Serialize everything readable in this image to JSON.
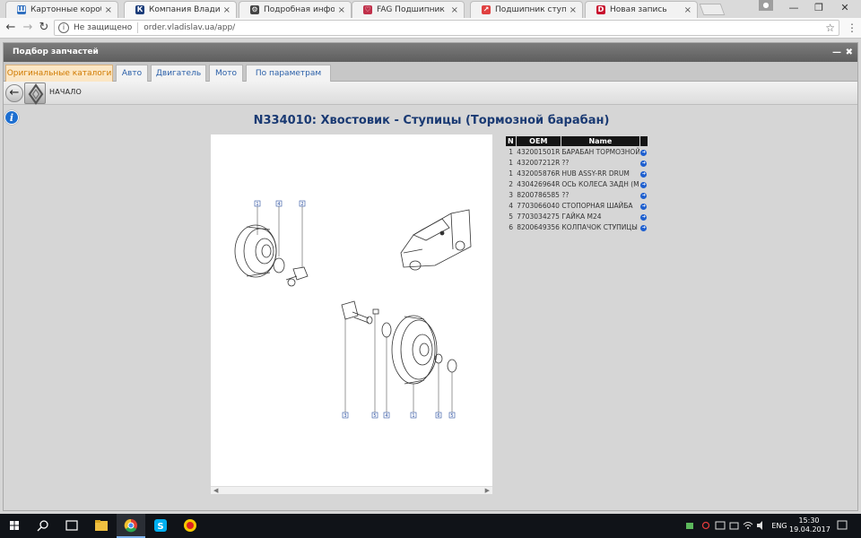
{
  "browser": {
    "tabs": [
      {
        "title": "Картонные коробки с д",
        "favicon_color": "#2f6fbf",
        "favicon_glyph": "Ш"
      },
      {
        "title": "Компания Владислав. С",
        "favicon_color": "#1c3d7a",
        "favicon_glyph": "К",
        "active": true
      },
      {
        "title": "Подробная информаци",
        "favicon_color": "#444444",
        "favicon_glyph": "⚙"
      },
      {
        "title": "FAG Подшипник маточи",
        "favicon_color": "#c0304a",
        "favicon_glyph": "♡"
      },
      {
        "title": "Подшипник ступицы кол",
        "favicon_color": "#e04040",
        "favicon_glyph": "↗"
      },
      {
        "title": "Новая запись",
        "favicon_color": "#c8102e",
        "favicon_glyph": "D"
      }
    ],
    "security_label": "Не защищено",
    "url": "order.vladislav.ua/app/"
  },
  "app": {
    "window_title": "Подбор запчастей",
    "tabs": [
      {
        "label": "Оригинальные каталоги",
        "active": true
      },
      {
        "label": "Авто"
      },
      {
        "label": "Двигатель"
      },
      {
        "label": "Мото"
      },
      {
        "label": "По параметрам"
      }
    ],
    "breadcrumb": "НАЧАЛО",
    "page_title": "N334010: Хвостовик - Ступицы (Тормозной барабан)"
  },
  "diagram": {
    "callouts": [
      "1",
      "4",
      "2",
      "3",
      "5",
      "4",
      "1",
      "6",
      "5"
    ]
  },
  "parts_table": {
    "headers": [
      "N",
      "OEM",
      "Name"
    ],
    "rows": [
      {
        "n": "1",
        "oem": "432001501R",
        "name": "БАРАБАН ТОРМОЗНОЙ"
      },
      {
        "n": "1",
        "oem": "432007212R",
        "name": "??"
      },
      {
        "n": "1",
        "oem": "432005876R",
        "name": "HUB ASSY-RR DRUM"
      },
      {
        "n": "2",
        "oem": "430426964R",
        "name": "ОСЬ КОЛЕСА ЗАДН (М"
      },
      {
        "n": "3",
        "oem": "8200786585",
        "name": "??"
      },
      {
        "n": "4",
        "oem": "7703066040",
        "name": "СТОПОРНАЯ ШАЙБА"
      },
      {
        "n": "5",
        "oem": "7703034275",
        "name": "ГАЙКА М24"
      },
      {
        "n": "6",
        "oem": "8200649356",
        "name": "КОЛПАЧОК СТУПИЦЫ З"
      }
    ]
  },
  "taskbar": {
    "lang": "ENG",
    "time": "15:30",
    "date": "19.04.2017"
  }
}
